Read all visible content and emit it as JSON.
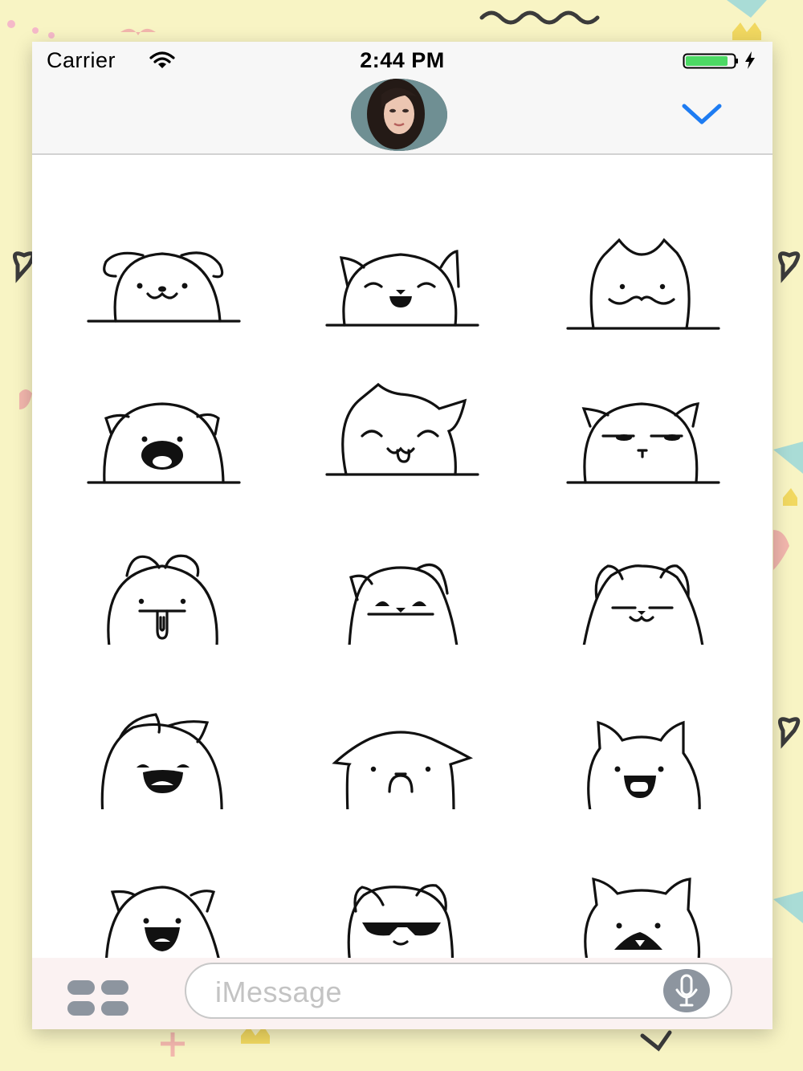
{
  "status_bar": {
    "carrier": "Carrier",
    "time": "2:44 PM",
    "wifi_icon": "wifi-icon",
    "battery_icon": "battery-charging-icon"
  },
  "header": {
    "avatar": "contact-avatar",
    "collapse_icon": "chevron-down-icon",
    "accent_color": "#1e7cf2"
  },
  "stickers": [
    {
      "id": "dog-smile"
    },
    {
      "id": "cat-laugh"
    },
    {
      "id": "fox-mustache"
    },
    {
      "id": "bear-shout"
    },
    {
      "id": "cat-tongue"
    },
    {
      "id": "cat-unimpressed"
    },
    {
      "id": "bunny-drool"
    },
    {
      "id": "cat-squint"
    },
    {
      "id": "cat-smug"
    },
    {
      "id": "bunny-laugh"
    },
    {
      "id": "dog-frown"
    },
    {
      "id": "fox-drool"
    },
    {
      "id": "bear-grin"
    },
    {
      "id": "cat-sunglasses"
    },
    {
      "id": "fox-scream"
    }
  ],
  "input_bar": {
    "apps_icon": "app-drawer-icon",
    "placeholder": "iMessage",
    "mic_icon": "microphone-icon"
  }
}
